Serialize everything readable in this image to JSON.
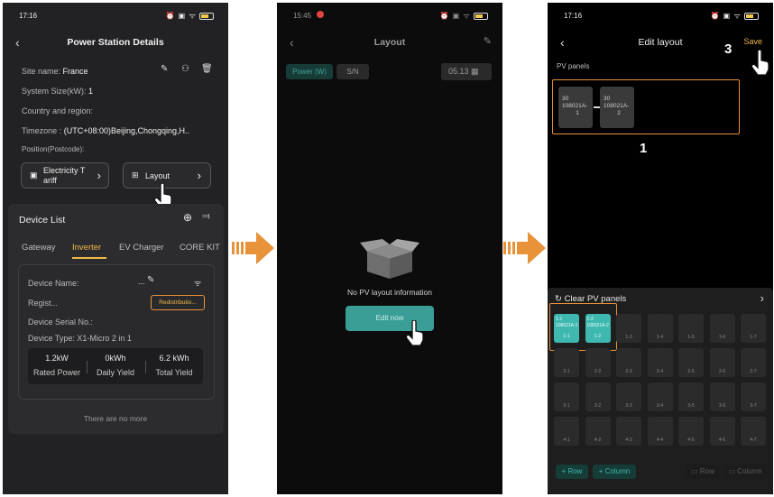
{
  "screen1": {
    "status_time": "17:16",
    "title": "Power Station Details",
    "site_name_label": "Site name:",
    "site_name_value": "France",
    "system_size_label": "System Size(kW):",
    "system_size_value": "1",
    "country_label": "Country and region:",
    "timezone_label": "Timezone :",
    "timezone_value": "(UTC+08:00)Beijing,Chongqing,H..",
    "position_label": "Position(Postcode):",
    "tariff_button_line1": "Electricity T",
    "tariff_button_line2": "ariff",
    "layout_button": "Layout",
    "device_list_title": "Device List",
    "tabs": [
      "Gateway",
      "Inverter",
      "EV Charger",
      "CORE KIT"
    ],
    "active_tab": "Inverter",
    "device_name_label": "Device Name:",
    "device_name_value": "...",
    "regist_label": "Regist...",
    "redistribution_button": "Redistributio...",
    "serial_label": "Device Serial No.:",
    "device_type_label": "Device Type: X1-Micro 2 in 1",
    "stats": [
      {
        "value": "1.2kW",
        "label": "Rated Power"
      },
      {
        "value": "0kWh",
        "label": "Daily Yield"
      },
      {
        "value": "6.2 kWh",
        "label": "Total Yield"
      }
    ],
    "no_more": "There are no more"
  },
  "screen2": {
    "status_time": "15:45",
    "title": "Layout",
    "filter_power": "Power (W)",
    "filter_sn": "S/N",
    "date": "05.13",
    "empty_text": "No PV layout information",
    "edit_button": "Edit now"
  },
  "screen3": {
    "status_time": "17:16",
    "title": "Edit layout",
    "save_button": "Save",
    "pv_panels_label": "PV panels",
    "placed_panels": [
      {
        "line1": "30",
        "line2": "108021A-",
        "line3": "1"
      },
      {
        "line1": "30",
        "line2": "108021A-",
        "line3": "2"
      }
    ],
    "clear_button": "Clear PV panels",
    "tray_selected": [
      {
        "line1": "1-1",
        "line2": "108021A-1",
        "pos": "1-1"
      },
      {
        "line1": "1-2",
        "line2": "108021A-2",
        "pos": "1-2"
      }
    ],
    "grid_rows": [
      [
        "1-3",
        "1-4",
        "1-5",
        "1-6",
        "1-7"
      ],
      [
        "2-1",
        "2-2",
        "2-3",
        "2-4",
        "2-5",
        "2-6",
        "2-7"
      ],
      [
        "3-1",
        "3-2",
        "3-3",
        "3-4",
        "3-5",
        "3-6",
        "3-7"
      ],
      [
        "4-1",
        "4-2",
        "4-3",
        "4-4",
        "4-5",
        "4-6",
        "4-7"
      ]
    ],
    "add_row": "+ Row",
    "add_column": "+ Column",
    "del_row": "Row",
    "del_column": "Column",
    "step_labels": [
      "1",
      "2",
      "3"
    ]
  },
  "colors": {
    "accent_orange": "#e8923a",
    "teal": "#3fb8b0",
    "active_tab": "#f2b84b"
  }
}
